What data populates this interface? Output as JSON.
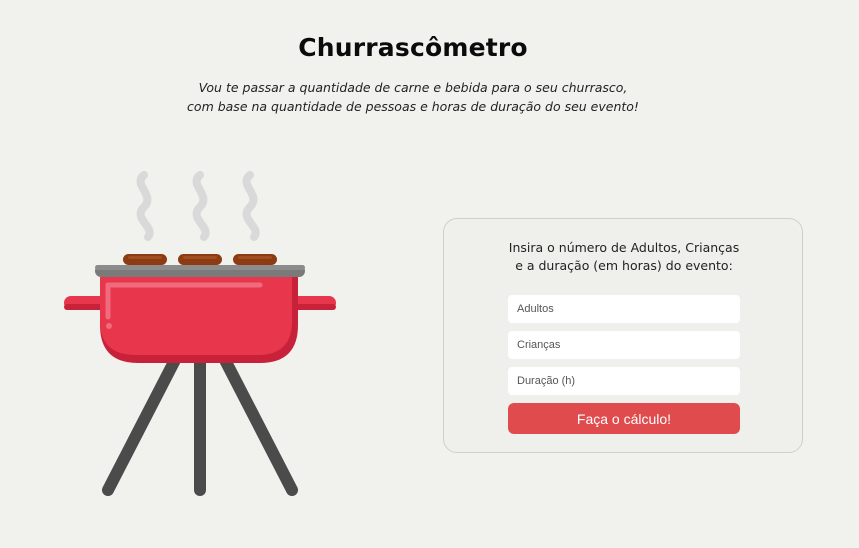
{
  "header": {
    "title": "Churrascômetro",
    "subtitle_line1": "Vou te passar a quantidade de carne e bebida para o seu churrasco,",
    "subtitle_line2": "com base na quantidade de pessoas e horas de duração do seu evento!"
  },
  "illustration": {
    "icon": "barbecue-grill-icon",
    "colors": {
      "body": "#e8364d",
      "legs": "#4b4b4b",
      "meat": "#8c3b12",
      "smoke": "#d9d9d9"
    }
  },
  "form": {
    "instructions_line1": "Insira o número de Adultos, Crianças",
    "instructions_line2": "e a duração (em horas) do evento:",
    "adults_placeholder": "Adultos",
    "children_placeholder": "Crianças",
    "duration_placeholder": "Duração (h)",
    "submit_label": "Faça o cálculo!",
    "button_color": "#e04b4d"
  }
}
